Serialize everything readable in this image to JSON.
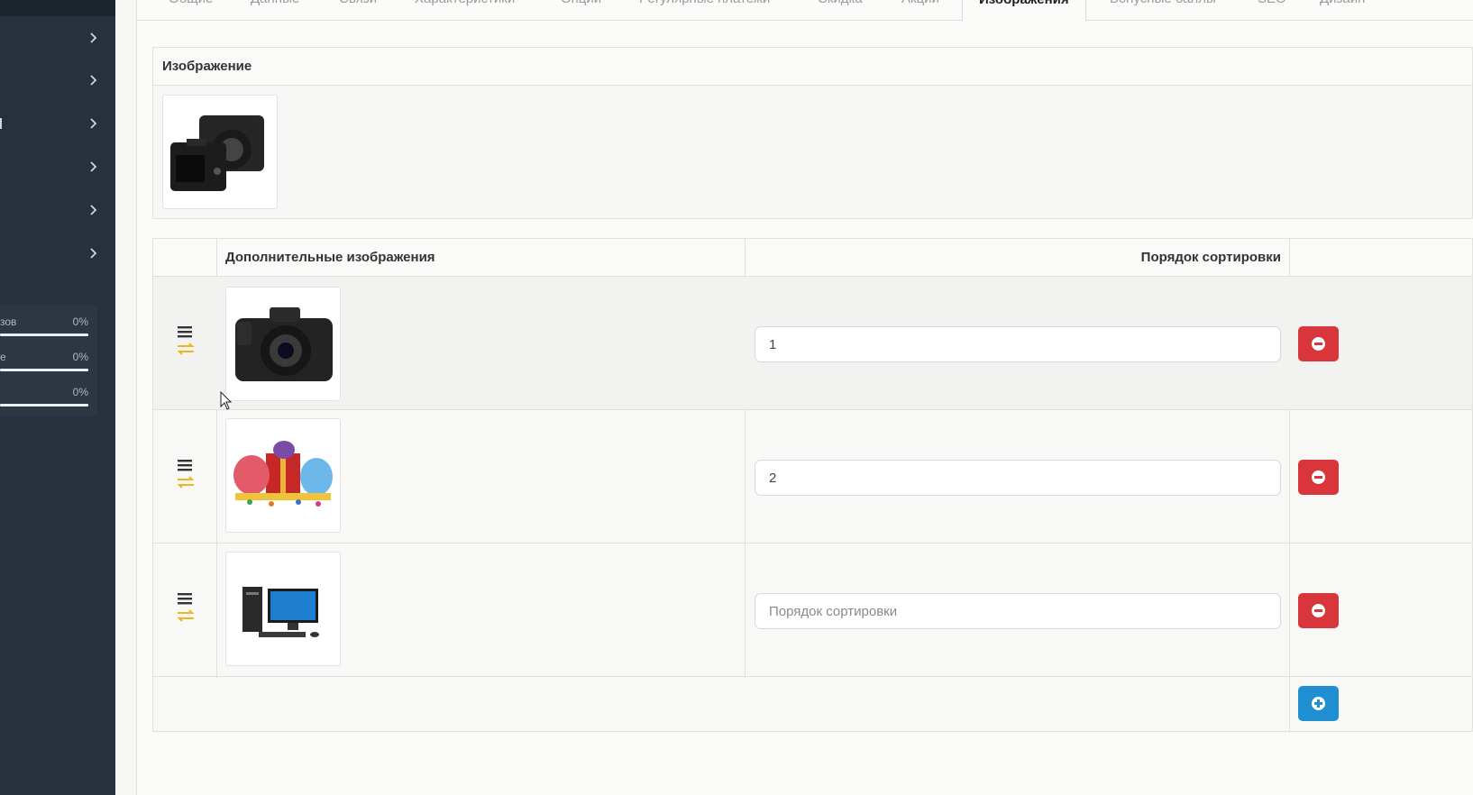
{
  "sidebar": {
    "menu_items": [
      {
        "icon": "chevron-right-icon"
      },
      {
        "icon": "chevron-right-icon"
      },
      {
        "icon": "chevron-right-icon"
      },
      {
        "icon": "chevron-right-icon"
      },
      {
        "icon": "chevron-right-icon"
      },
      {
        "icon": "chevron-right-icon"
      }
    ],
    "stats": [
      {
        "label": "зов",
        "percent": "0%",
        "fill": 0
      },
      {
        "label": "е",
        "percent": "0%",
        "fill": 0
      },
      {
        "label": "",
        "percent": "0%",
        "fill": 0
      }
    ]
  },
  "tabs": [
    {
      "label": "Общие",
      "active": false
    },
    {
      "label": "Данные",
      "active": false
    },
    {
      "label": "Связи",
      "active": false
    },
    {
      "label": "Характеристики",
      "active": false
    },
    {
      "label": "Опции",
      "active": false
    },
    {
      "label": "Регулярные платежи",
      "active": false
    },
    {
      "label": "Скидка",
      "active": false
    },
    {
      "label": "Акции",
      "active": false
    },
    {
      "label": "Изображения",
      "active": true
    },
    {
      "label": "Бонусные баллы",
      "active": false
    },
    {
      "label": "SEO",
      "active": false
    },
    {
      "label": "Дизайн",
      "active": false
    }
  ],
  "main_image": {
    "title": "Изображение",
    "image": "camera-dslr-image"
  },
  "additional_images": {
    "column_image": "Дополнительные изображения",
    "column_sort": "Порядок сортировки",
    "sort_placeholder": "Порядок сортировки",
    "rows": [
      {
        "image": "camera-dslr-image",
        "sort_value": "1"
      },
      {
        "image": "party-balloons-gift-image",
        "sort_value": "2"
      },
      {
        "image": "desktop-computer-image",
        "sort_value": ""
      }
    ],
    "remove_icon": "minus-circle-icon",
    "add_icon": "plus-circle-icon",
    "drag_icon": "bars-icon",
    "swap_icon": "exchange-icon"
  },
  "colors": {
    "sidebar": "#26313b",
    "remove_button": "#d8363b",
    "add_button": "#1f8fd2",
    "swap_icon": "#f3b41b"
  }
}
